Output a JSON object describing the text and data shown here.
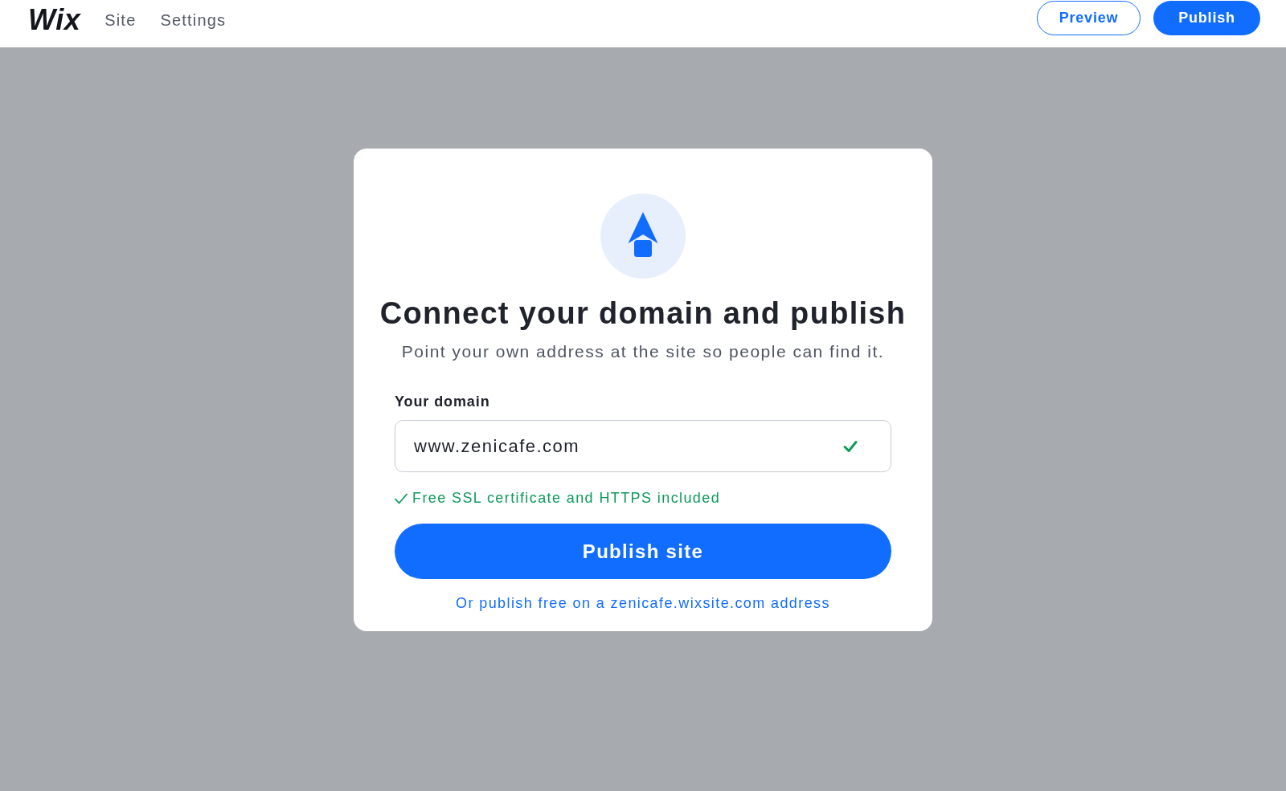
{
  "header": {
    "logo": "Wix",
    "nav": [
      {
        "label": "Site"
      },
      {
        "label": "Settings"
      }
    ],
    "buttons": [
      {
        "label": "Preview",
        "kind": "outline"
      },
      {
        "label": "Publish",
        "kind": "primary"
      }
    ]
  },
  "dialog": {
    "title": "Connect your domain and publish",
    "subtitle": "Point your own address at the site so people can find it.",
    "field": {
      "label": "Your domain",
      "value": "www.zenicafe.com",
      "valid": true
    },
    "note": "Free SSL certificate and HTTPS included",
    "primary_button": "Publish site",
    "link": "Or publish free on a zenicafe.wixsite.com address"
  }
}
